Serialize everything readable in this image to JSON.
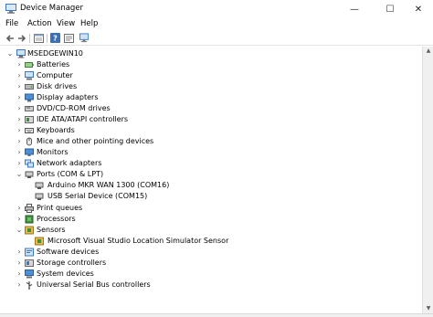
{
  "window": {
    "title": "Device Manager",
    "controls": {
      "minimize": "—",
      "maximize": "☐",
      "close": "✕"
    }
  },
  "menu": [
    "File",
    "Action",
    "View",
    "Help"
  ],
  "toolbar": {
    "buttons": [
      "back-icon",
      "forward-icon",
      "properties-icon",
      "help-icon",
      "scan-hardware-icon"
    ]
  },
  "tree": {
    "root": "MSEDGEWIN10",
    "items": [
      {
        "label": "Batteries",
        "icon": "battery-icon",
        "expanded": false
      },
      {
        "label": "Computer",
        "icon": "computer-icon",
        "expanded": false
      },
      {
        "label": "Disk drives",
        "icon": "disk-drive-icon",
        "expanded": false
      },
      {
        "label": "Display adapters",
        "icon": "display-adapter-icon",
        "expanded": false
      },
      {
        "label": "DVD/CD-ROM drives",
        "icon": "dvd-drive-icon",
        "expanded": false
      },
      {
        "label": "IDE ATA/ATAPI controllers",
        "icon": "ide-controller-icon",
        "expanded": false
      },
      {
        "label": "Keyboards",
        "icon": "keyboard-icon",
        "expanded": false
      },
      {
        "label": "Mice and other pointing devices",
        "icon": "mouse-icon",
        "expanded": false
      },
      {
        "label": "Monitors",
        "icon": "monitor-icon",
        "expanded": false
      },
      {
        "label": "Network adapters",
        "icon": "network-adapter-icon",
        "expanded": false
      },
      {
        "label": "Ports (COM & LPT)",
        "icon": "port-icon",
        "expanded": true,
        "children": [
          {
            "label": "Arduino MKR WAN 1300 (COM16)",
            "icon": "port-device-icon"
          },
          {
            "label": "USB Serial Device (COM15)",
            "icon": "port-device-icon"
          }
        ]
      },
      {
        "label": "Print queues",
        "icon": "printer-icon",
        "expanded": false
      },
      {
        "label": "Processors",
        "icon": "processor-icon",
        "expanded": false
      },
      {
        "label": "Sensors",
        "icon": "sensor-icon",
        "expanded": true,
        "children": [
          {
            "label": "Microsoft Visual Studio Location Simulator Sensor",
            "icon": "sensor-device-icon"
          }
        ]
      },
      {
        "label": "Software devices",
        "icon": "software-device-icon",
        "expanded": false
      },
      {
        "label": "Storage controllers",
        "icon": "storage-controller-icon",
        "expanded": false
      },
      {
        "label": "System devices",
        "icon": "system-device-icon",
        "expanded": false
      },
      {
        "label": "Universal Serial Bus controllers",
        "icon": "usb-icon",
        "expanded": false
      }
    ]
  },
  "colors": {
    "accent_blue": "#3b78c4",
    "folder_yellow": "#e7b94a",
    "chip_green": "#3f8f3f"
  }
}
